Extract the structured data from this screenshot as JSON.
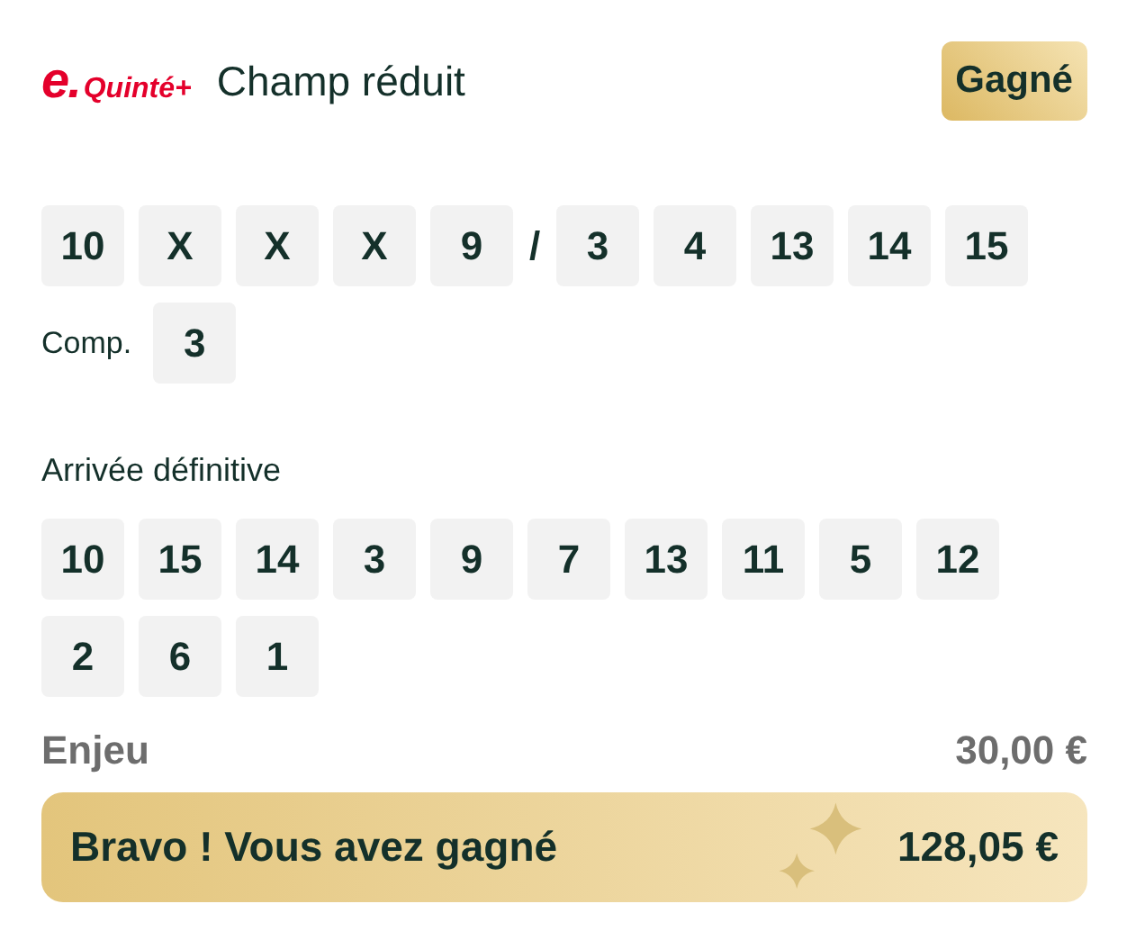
{
  "header": {
    "logo_mark": "e.",
    "logo_text": "Quinté+",
    "title": "Champ réduit",
    "status": "Gagné"
  },
  "selection": [
    {
      "kind": "number",
      "label": "10"
    },
    {
      "kind": "number",
      "label": "X"
    },
    {
      "kind": "number",
      "label": "X"
    },
    {
      "kind": "number",
      "label": "X"
    },
    {
      "kind": "number",
      "label": "9"
    },
    {
      "kind": "separator",
      "label": "/"
    },
    {
      "kind": "number",
      "label": "3"
    },
    {
      "kind": "number",
      "label": "4"
    },
    {
      "kind": "number",
      "label": "13"
    },
    {
      "kind": "number",
      "label": "14"
    },
    {
      "kind": "number",
      "label": "15"
    }
  ],
  "complement": {
    "label": "Comp.",
    "numbers": [
      "3"
    ]
  },
  "arrival": {
    "title": "Arrivée définitive",
    "numbers": [
      "10",
      "15",
      "14",
      "3",
      "9",
      "7",
      "13",
      "11",
      "5",
      "12",
      "2",
      "6",
      "1"
    ]
  },
  "stake": {
    "label": "Enjeu",
    "amount": "30,00 €"
  },
  "winnings": {
    "message": "Bravo ! Vous avez gagné",
    "amount": "128,05 €"
  }
}
